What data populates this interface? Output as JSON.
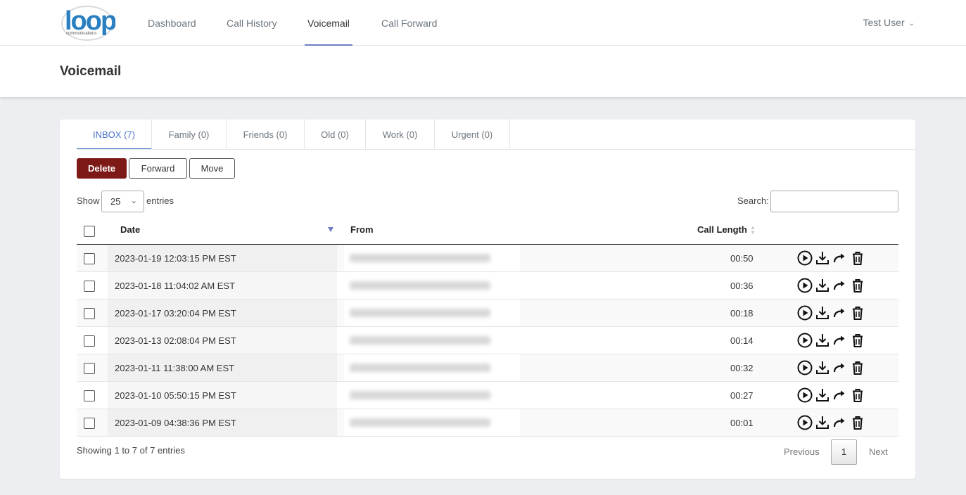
{
  "header": {
    "logo_text": "loop",
    "logo_subtext": "communications",
    "nav": [
      {
        "label": "Dashboard",
        "active": false
      },
      {
        "label": "Call History",
        "active": false
      },
      {
        "label": "Voicemail",
        "active": true
      },
      {
        "label": "Call Forward",
        "active": false
      }
    ],
    "user": "Test User",
    "logo_color": "#2a7fc1"
  },
  "page": {
    "title": "Voicemail"
  },
  "tabs": [
    {
      "label": "INBOX (7)",
      "active": true
    },
    {
      "label": "Family (0)",
      "active": false
    },
    {
      "label": "Friends (0)",
      "active": false
    },
    {
      "label": "Old (0)",
      "active": false
    },
    {
      "label": "Work (0)",
      "active": false
    },
    {
      "label": "Urgent (0)",
      "active": false
    }
  ],
  "toolbar": {
    "delete_label": "Delete",
    "forward_label": "Forward",
    "move_label": "Move",
    "delete_color": "#7d1a18"
  },
  "length_menu": {
    "show_label": "Show",
    "value": "25",
    "entries_label": "entries"
  },
  "search": {
    "label": "Search:",
    "value": ""
  },
  "table": {
    "columns": {
      "date": "Date",
      "from": "From",
      "length": "Call Length"
    },
    "sorted_column": "date",
    "sort_direction": "descending",
    "rows": [
      {
        "date": "2023-01-19 12:03:15 PM EST",
        "from_redacted": true,
        "length": "00:50"
      },
      {
        "date": "2023-01-18 11:04:02 AM EST",
        "from_redacted": true,
        "length": "00:36"
      },
      {
        "date": "2023-01-17 03:20:04 PM EST",
        "from_redacted": true,
        "length": "00:18"
      },
      {
        "date": "2023-01-13 02:08:04 PM EST",
        "from_redacted": true,
        "length": "00:14"
      },
      {
        "date": "2023-01-11 11:38:00 AM EST",
        "from_redacted": true,
        "length": "00:32"
      },
      {
        "date": "2023-01-10 05:50:15 PM EST",
        "from_redacted": true,
        "length": "00:27"
      },
      {
        "date": "2023-01-09 04:38:36 PM EST",
        "from_redacted": true,
        "length": "00:01"
      }
    ],
    "row_actions": [
      "play-icon",
      "download-icon",
      "forward-arrow-icon",
      "trash-icon"
    ]
  },
  "footer": {
    "info": "Showing 1 to 7 of 7 entries",
    "prev_label": "Previous",
    "page": "1",
    "next_label": "Next"
  }
}
